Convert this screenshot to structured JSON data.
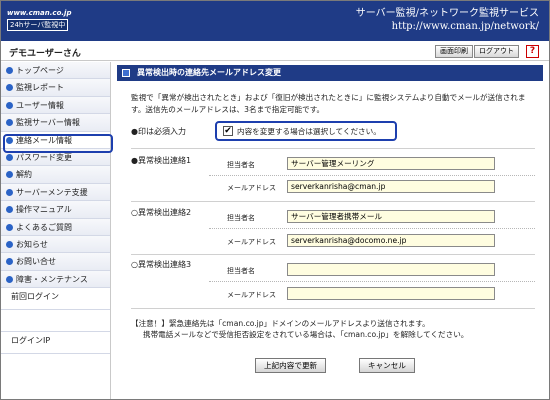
{
  "header": {
    "logo_line1": "www.cman.co.jp",
    "logo_line2": "24hサーバ監視中",
    "title_line1": "サーバー監視/ネットワーク監視サービス",
    "title_line2": "http://www.cman.jp/network/",
    "background_color": "#1f3b86"
  },
  "userbar": {
    "user_name": "デモユーザーさん",
    "print_label": "画面印刷",
    "logout_label": "ログアウト",
    "help_icon": "?"
  },
  "sidebar": {
    "items": [
      {
        "label": "トップページ"
      },
      {
        "label": "監視レポート"
      },
      {
        "label": "ユーザー情報"
      },
      {
        "label": "監視サーバー情報"
      },
      {
        "label": "連絡メール情報"
      },
      {
        "label": "パスワード変更"
      },
      {
        "label": "解約"
      },
      {
        "label": "サーバーメンテ支援"
      },
      {
        "label": "操作マニュアル"
      },
      {
        "label": "よくあるご質問"
      },
      {
        "label": "お知らせ"
      },
      {
        "label": "お問い合せ"
      },
      {
        "label": "障害・メンテナンス"
      }
    ],
    "last_login_label": "前回ログイン",
    "login_ip_label": "ログインIP"
  },
  "main": {
    "section_title": "異常検出時の連絡先メールアドレス変更",
    "intro": "監視で「異常が検出されたとき」および「復旧が検出されたときに」に監視システムより自動でメールが送信されます。送信先のメールアドレスは、3名まで指定可能です。",
    "required_label": "●印は必須入力",
    "checkbox_mark": "✔",
    "checkbox_label": "内容を変更する場合は選択してください。",
    "contacts": [
      {
        "label": "●異常検出連絡1",
        "name_label": "担当者名",
        "name_value": "サーバー管理メーリング",
        "mail_label": "メールアドレス",
        "mail_value": "serverkanrisha@cman.jp"
      },
      {
        "label": "○異常検出連絡2",
        "name_label": "担当者名",
        "name_value": "サーバー管理者携帯メール",
        "mail_label": "メールアドレス",
        "mail_value": "serverkanrisha@docomo.ne.jp"
      },
      {
        "label": "○異常検出連絡3",
        "name_label": "担当者名",
        "name_value": "",
        "mail_label": "メールアドレス",
        "mail_value": ""
      }
    ],
    "note_line1": "【注意！】緊急連絡先は「cman.co.jp」ドメインのメールアドレスより送信されます。",
    "note_line2": "携帯電話メールなどで受信拒否設定をされている場合は、「cman.co.jp」を解除してください。",
    "update_label": "上記内容で更新",
    "cancel_label": "キャンセル"
  }
}
